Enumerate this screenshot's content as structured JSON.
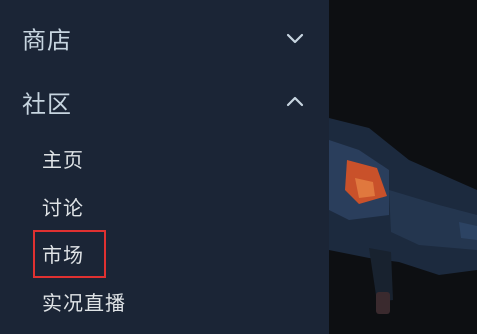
{
  "sidebar": {
    "sections": [
      {
        "label": "商店",
        "icon": "chevron-down-icon",
        "expanded": false
      },
      {
        "label": "社区",
        "icon": "chevron-up-icon",
        "expanded": true
      }
    ],
    "community_items": [
      {
        "label": "主页"
      },
      {
        "label": "讨论"
      },
      {
        "label": "市场",
        "highlighted": true
      },
      {
        "label": "实况直播"
      }
    ]
  },
  "colors": {
    "sidebar_bg": "#1b2536",
    "text": "#c7d5e0",
    "highlight": "#e03131"
  }
}
